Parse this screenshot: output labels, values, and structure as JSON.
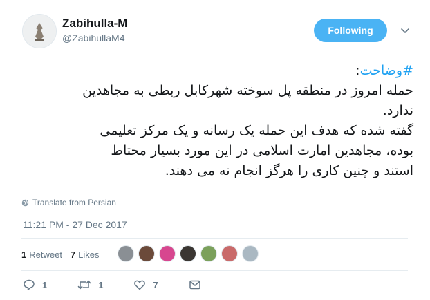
{
  "user": {
    "name": "Zabihulla-M",
    "handle": "@ZabihullaM4",
    "follow_label": "Following"
  },
  "tweet": {
    "hashtag": "#وضاحت",
    "lines": [
      "حمله امروز در منطقه پل سوخته شهرکابل ربطی به مجاهدین",
      "ندارد.",
      "گفته شده که هدف این حمله یک رسانه و یک مرکز تعلیمی",
      "بوده، مجاهدین امارت اسلامی در این مورد بسیار محتاط",
      "استند و چنین کاری را هرگز انجام نه می دهند."
    ],
    "translate_label": "Translate from Persian",
    "timestamp": "11:21 PM - 27 Dec 2017"
  },
  "stats": {
    "retweets_count": "1",
    "retweets_label": "Retweet",
    "likes_count": "7",
    "likes_label": "Likes"
  },
  "actions": {
    "reply_count": "1",
    "retweet_count": "1",
    "like_count": "7"
  },
  "colors": {
    "accent": "#1da1f2",
    "follow_bg": "#4ab3f4",
    "muted": "#657786"
  },
  "liker_avatar_colors": [
    "#8a8f94",
    "#6b4a3a",
    "#d7478f",
    "#3b3632",
    "#7ba05b",
    "#c96a6a",
    "#aab8c2"
  ]
}
